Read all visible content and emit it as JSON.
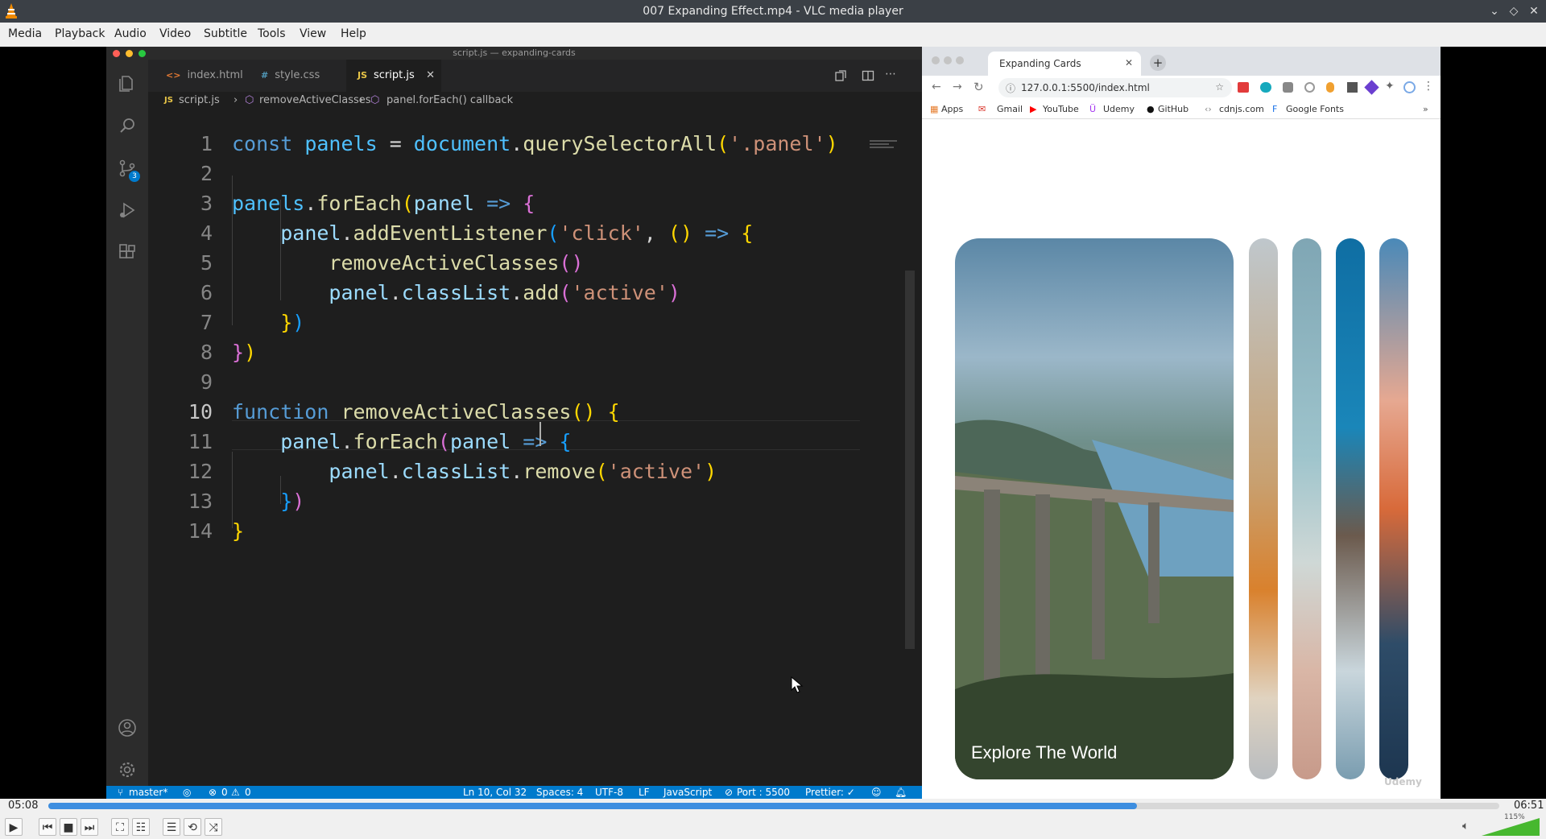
{
  "window": {
    "title": "007 Expanding Effect.mp4 - VLC media player"
  },
  "menu": [
    "Media",
    "Playback",
    "Audio",
    "Video",
    "Subtitle",
    "Tools",
    "View",
    "Help"
  ],
  "vscode": {
    "title": "script.js — expanding-cards",
    "tabs": [
      {
        "icon": "<>",
        "label": "index.html"
      },
      {
        "icon": "#",
        "label": "style.css"
      },
      {
        "icon": "JS",
        "label": "script.js"
      }
    ],
    "breadcrumb": [
      "script.js",
      "removeActiveClasses",
      "panel.forEach() callback"
    ],
    "source_control_badge": "3",
    "line_numbers": [
      "1",
      "2",
      "3",
      "4",
      "5",
      "6",
      "7",
      "8",
      "9",
      "10",
      "11",
      "12",
      "13",
      "14"
    ],
    "code_lines": [
      "const panels = document.querySelectorAll('.panel')",
      "",
      "panels.forEach(panel => {",
      "    panel.addEventListener('click', () => {",
      "        removeActiveClasses()",
      "        panel.classList.add('active')",
      "    })",
      "})",
      "",
      "function removeActiveClasses() {",
      "    panel.forEach(panel => {",
      "        panel.classList.remove('active')",
      "    })",
      "}"
    ],
    "status": {
      "branch": "master*",
      "problems": "0",
      "warnings": "0",
      "position": "Ln 10, Col 32",
      "spaces": "Spaces: 4",
      "encoding": "UTF-8",
      "eol": "LF",
      "language": "JavaScript",
      "port": "Port : 5500",
      "prettier": "Prettier: ✓"
    }
  },
  "browser": {
    "tab_title": "Expanding Cards",
    "url": "127.0.0.1:5500/index.html",
    "bookmarks": [
      "Apps",
      "Gmail",
      "YouTube",
      "Udemy",
      "GitHub",
      "cdnjs.com",
      "Google Fonts"
    ],
    "card_title": "Explore The World",
    "watermark": "Udemy"
  },
  "player": {
    "elapsed": "05:08",
    "total": "06:51",
    "progress_fraction": 0.75,
    "volume_label": "115%",
    "volume_fraction": 1.0,
    "accent": "#3d8ee0"
  }
}
